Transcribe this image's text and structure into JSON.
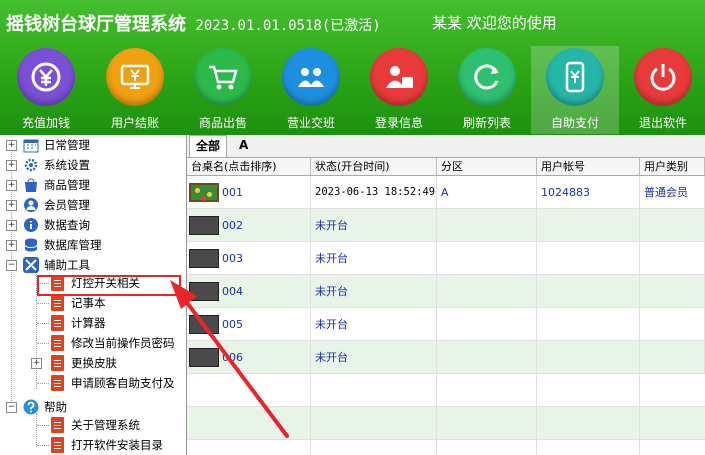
{
  "header": {
    "app_name": "摇钱树台球厅管理系统",
    "version": "2023.01.01.0518(已激活)",
    "welcome": "某某 欢迎您的使用"
  },
  "toolbar": [
    {
      "label": "充值加钱",
      "icon": "yen-coin-icon",
      "color": "#7b4fd6"
    },
    {
      "label": "用户结账",
      "icon": "monitor-yen-icon",
      "color": "#f0a010"
    },
    {
      "label": "商品出售",
      "icon": "shopping-cart-icon",
      "color": "#2db84a"
    },
    {
      "label": "营业交班",
      "icon": "shift-handover-icon",
      "color": "#1e8fe0"
    },
    {
      "label": "登录信息",
      "icon": "login-info-icon",
      "color": "#e83a3a"
    },
    {
      "label": "刷新列表",
      "icon": "refresh-icon",
      "color": "#2ec070"
    },
    {
      "label": "自助支付",
      "icon": "self-pay-phone-icon",
      "color": "#26b6a8"
    },
    {
      "label": "退出软件",
      "icon": "power-icon",
      "color": "#e83a3a"
    }
  ],
  "tree": {
    "items": [
      {
        "label": "日常管理",
        "icon": "calendar-icon"
      },
      {
        "label": "系统设置",
        "icon": "gear-icon"
      },
      {
        "label": "商品管理",
        "icon": "shopping-bag-icon"
      },
      {
        "label": "会员管理",
        "icon": "member-icon"
      },
      {
        "label": "数据查询",
        "icon": "info-icon"
      },
      {
        "label": "数据库管理",
        "icon": "database-icon"
      },
      {
        "label": "辅助工具",
        "icon": "tools-icon"
      },
      {
        "label": "灯控开关相关",
        "icon": "document-icon"
      },
      {
        "label": "记事本",
        "icon": "document-icon"
      },
      {
        "label": "计算器",
        "icon": "document-icon"
      },
      {
        "label": "修改当前操作员密码",
        "icon": "document-icon"
      },
      {
        "label": "更换皮肤",
        "icon": "document-icon"
      },
      {
        "label": "申请顾客自助支付及",
        "icon": "document-icon"
      },
      {
        "label": "帮助",
        "icon": "help-icon"
      },
      {
        "label": "关于管理系统",
        "icon": "document-icon"
      },
      {
        "label": "打开软件安装目录",
        "icon": "document-icon"
      }
    ]
  },
  "tabs": [
    {
      "label": "全部"
    },
    {
      "label": "A"
    }
  ],
  "table": {
    "columns": [
      "台桌名(点击排序)",
      "状态(开台时间)",
      "分区",
      "用户帐号",
      "用户类别"
    ],
    "rows": [
      {
        "name": "001",
        "status": "2023-06-13 18:52:49",
        "zone": "A",
        "account": "1024883",
        "type": "普通会员",
        "in_use": true
      },
      {
        "name": "002",
        "status": "未开台",
        "zone": "",
        "account": "",
        "type": "",
        "in_use": false
      },
      {
        "name": "003",
        "status": "未开台",
        "zone": "",
        "account": "",
        "type": "",
        "in_use": false
      },
      {
        "name": "004",
        "status": "未开台",
        "zone": "",
        "account": "",
        "type": "",
        "in_use": false
      },
      {
        "name": "005",
        "status": "未开台",
        "zone": "",
        "account": "",
        "type": "",
        "in_use": false
      },
      {
        "name": "006",
        "status": "未开台",
        "zone": "",
        "account": "",
        "type": "",
        "in_use": false
      }
    ]
  },
  "colors": {
    "header_green": "#2aa316",
    "highlight_red": "#e8262a",
    "row_alt": "#e9f4e8",
    "cell_text": "#1a2fb4"
  }
}
